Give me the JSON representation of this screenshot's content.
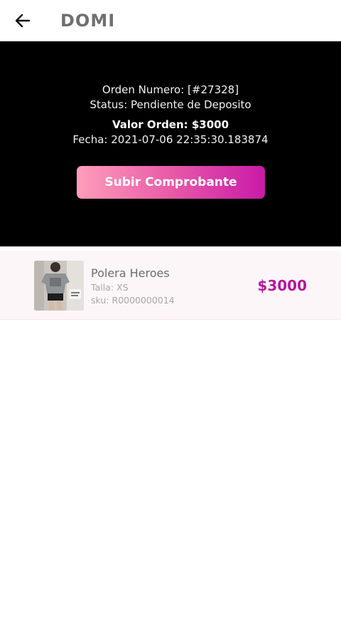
{
  "header": {
    "title": "DOMI",
    "back_icon": "arrow-left-icon"
  },
  "order": {
    "number_line": "Orden Numero: [#27328]",
    "status_line": "Status: Pendiente de Deposito",
    "value_line": "Valor Orden: $3000",
    "date_line": "Fecha: 2021-07-06 22:35:30.183874",
    "upload_button_label": "Subir Comprobante"
  },
  "items": [
    {
      "name": "Polera Heroes",
      "size": "Talla: XS",
      "sku": "sku: R0000000014",
      "price": "$3000",
      "image_icon": "product-photo"
    }
  ],
  "colors": {
    "accent": "#b5179e",
    "button_gradient_start": "#ff9ebb",
    "button_gradient_end": "#c91aa8",
    "panel_bg": "#000000"
  }
}
